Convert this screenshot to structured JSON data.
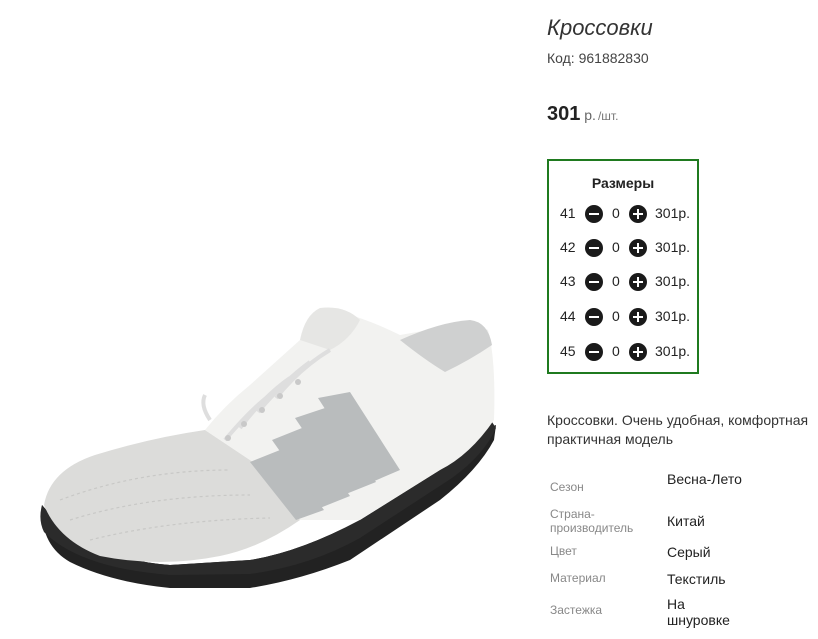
{
  "product": {
    "title": "Кроссовки",
    "code": "Код: 961882830",
    "price_value": "301",
    "price_currency": " р.",
    "price_unit": "/шт."
  },
  "sizes": {
    "title": "Размеры",
    "rows": [
      {
        "size": "41",
        "qty": "0",
        "price": "301р."
      },
      {
        "size": "42",
        "qty": "0",
        "price": "301р."
      },
      {
        "size": "43",
        "qty": "0",
        "price": "301р."
      },
      {
        "size": "44",
        "qty": "0",
        "price": "301р."
      },
      {
        "size": "45",
        "qty": "0",
        "price": "301р."
      }
    ]
  },
  "description": "Кроссовки. Очень удобная, комфортная практичная модель",
  "attributes": [
    {
      "key": "Сезон",
      "value": "Весна-Лето"
    },
    {
      "key": "Страна-производитель",
      "value": "Китай"
    },
    {
      "key": "Цвет",
      "value": "Серый"
    },
    {
      "key": "Материал",
      "value": "Текстиль"
    },
    {
      "key": "Застежка",
      "value": "На шнуровке"
    }
  ],
  "colors": {
    "sizes_border": "#1f7a1f",
    "stripe": "#b9bcbd",
    "sole": "#222222",
    "upper": "#f4f4f2",
    "toe": "#dcdcda"
  },
  "icons": {
    "minus": "minus-circle-icon",
    "plus": "plus-circle-icon"
  }
}
